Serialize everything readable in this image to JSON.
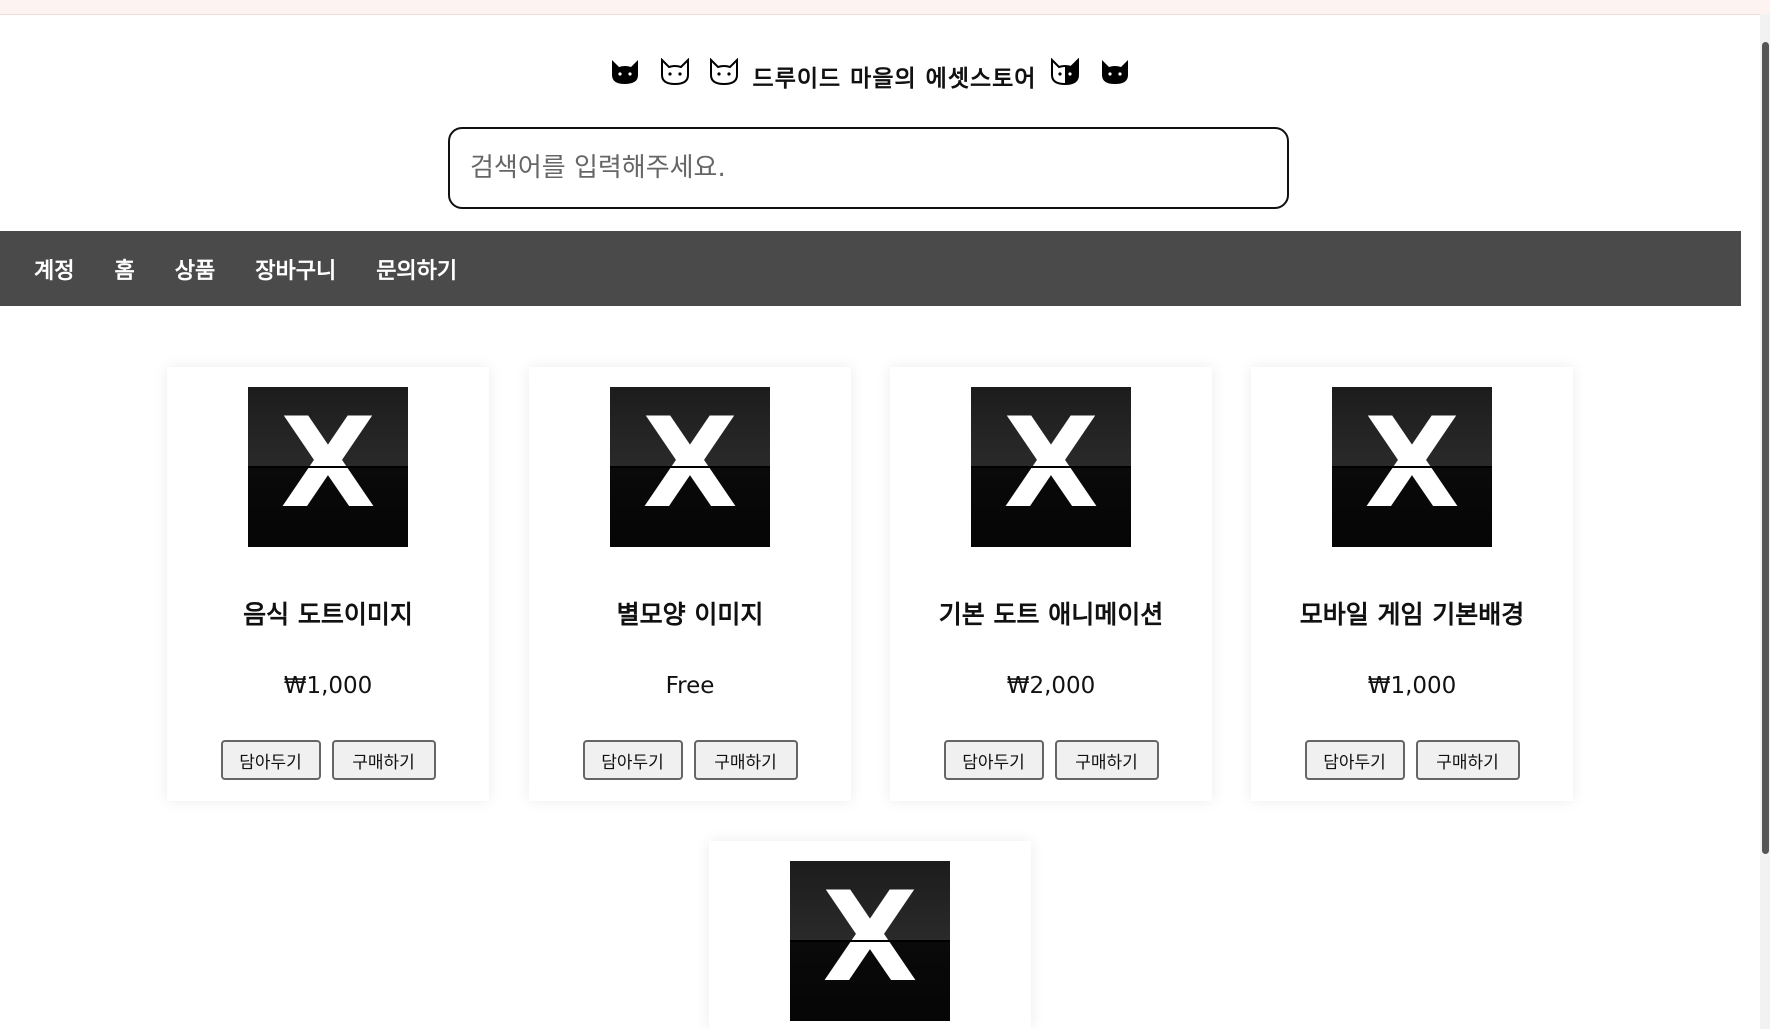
{
  "header": {
    "title_text": "드루이드 마을의 에셋스토어",
    "cats_left": [
      "🐱",
      "🐱",
      "🐱"
    ],
    "cats_right": [
      "🐱",
      "🐱"
    ]
  },
  "search": {
    "placeholder": "검색어를 입력해주세요.",
    "value": ""
  },
  "nav": {
    "items": [
      "계정",
      "홈",
      "상품",
      "장바구니",
      "문의하기"
    ]
  },
  "products": [
    {
      "title": "음식 도트이미지",
      "price": "₩1,000",
      "image_icon": "x-icon"
    },
    {
      "title": "별모양 이미지",
      "price": "Free",
      "image_icon": "x-icon"
    },
    {
      "title": "기본 도트 애니메이션",
      "price": "₩2,000",
      "image_icon": "x-icon"
    },
    {
      "title": "모바일 게임 기본배경",
      "price": "₩1,000",
      "image_icon": "x-icon"
    },
    {
      "title": "",
      "price": "",
      "image_icon": "x-icon"
    }
  ],
  "buttons": {
    "add_to_cart": "담아두기",
    "buy": "구매하기"
  },
  "image_glyph": "X"
}
